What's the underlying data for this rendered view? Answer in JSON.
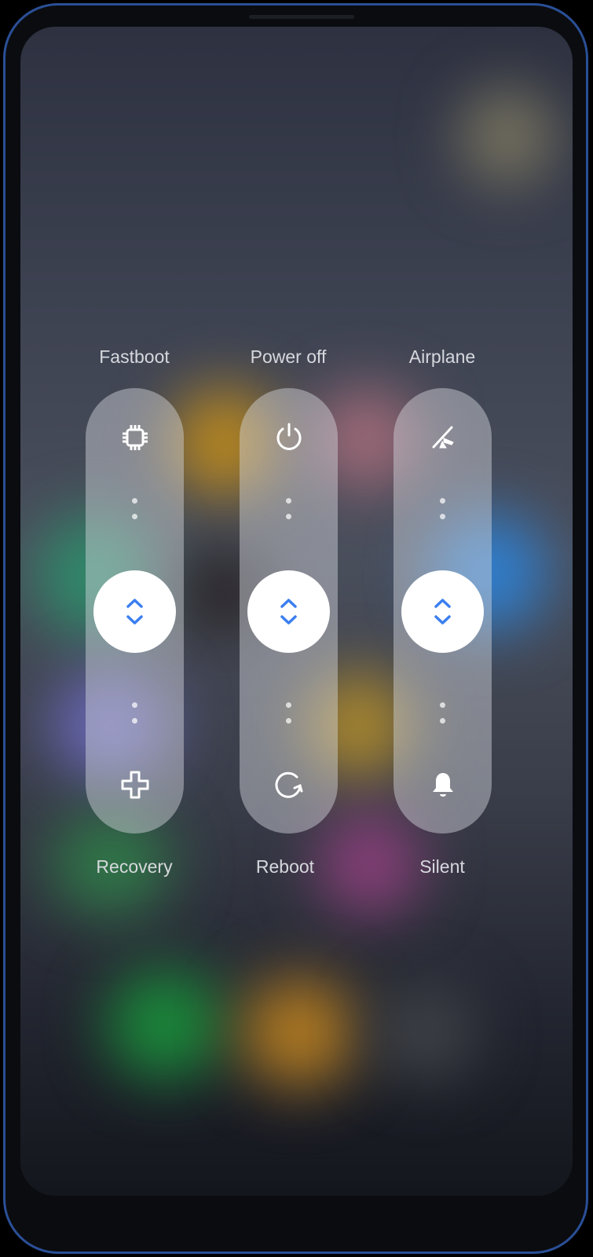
{
  "columns": [
    {
      "top_label": "Fastboot",
      "bottom_label": "Recovery",
      "top_icon": "chip-icon",
      "bottom_icon": "plus-icon"
    },
    {
      "top_label": "Power off",
      "bottom_label": "Reboot",
      "top_icon": "power-icon",
      "bottom_icon": "reboot-icon"
    },
    {
      "top_label": "Airplane",
      "bottom_label": "Silent",
      "top_icon": "airplane-off-icon",
      "bottom_icon": "bell-icon"
    }
  ],
  "colors": {
    "accent": "#3b7ff0",
    "knob": "#ffffff"
  }
}
